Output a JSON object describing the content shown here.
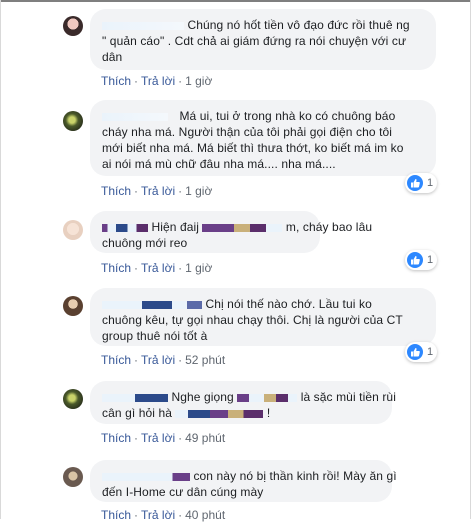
{
  "comments": [
    {
      "lines": [
        "Chúng nó hốt tiền vô đạo đức rồi thuê ng",
        "\" quản cáo\" . Cdt chả ai giám đứng ra nói chuyện với cư",
        "dân"
      ],
      "like_label": "Thích",
      "reply_label": "Trả lời",
      "time": "1 giờ"
    },
    {
      "lines": [
        "Má ui, tui ở trong nhà ko có chuông báo",
        "cháy nha má. Người thận của tôi phải gọi điện cho tôi",
        "mới biết nha má. Má biết thì thưa thớt, ko biết má im ko",
        "ai nói má mù chữ đâu nha má.... nha má...."
      ],
      "like_label": "Thích",
      "reply_label": "Trả lời",
      "time": "1 giờ",
      "reactions": "1"
    },
    {
      "lines": [
        "Hiện đaij",
        "m, cháy bao lâu",
        "chuông mới reo"
      ],
      "like_label": "Thích",
      "reply_label": "Trả lời",
      "time": "1 giờ",
      "reactions": "1"
    },
    {
      "lines": [
        "Chị nói thế nào chớ. Lầu tui ko",
        "chuông kêu, tự gọi nhau chạy thôi. Chị là người của CT",
        "group thuê nói tốt à"
      ],
      "like_label": "Thích",
      "reply_label": "Trả lời",
      "time": "52 phút",
      "reactions": "1"
    },
    {
      "lines": [
        "Nghe giọng",
        "là sặc mùi tiền rùi",
        "cân gì hỏi hà",
        "!"
      ],
      "like_label": "Thích",
      "reply_label": "Trả lời",
      "time": "49 phút"
    },
    {
      "lines": [
        "con này nó bị thần kinh rồi! Mày ăn gì",
        "đến I-Home cư dân cúng mày"
      ],
      "like_label": "Thích",
      "reply_label": "Trả lời",
      "time": "40 phút"
    }
  ],
  "colors": {
    "bubble_bg": "#f2f3f5",
    "link": "#385898",
    "meta": "#606770",
    "like_blue": "#2d88ff"
  },
  "icons": [
    "avatar",
    "like-icon"
  ]
}
